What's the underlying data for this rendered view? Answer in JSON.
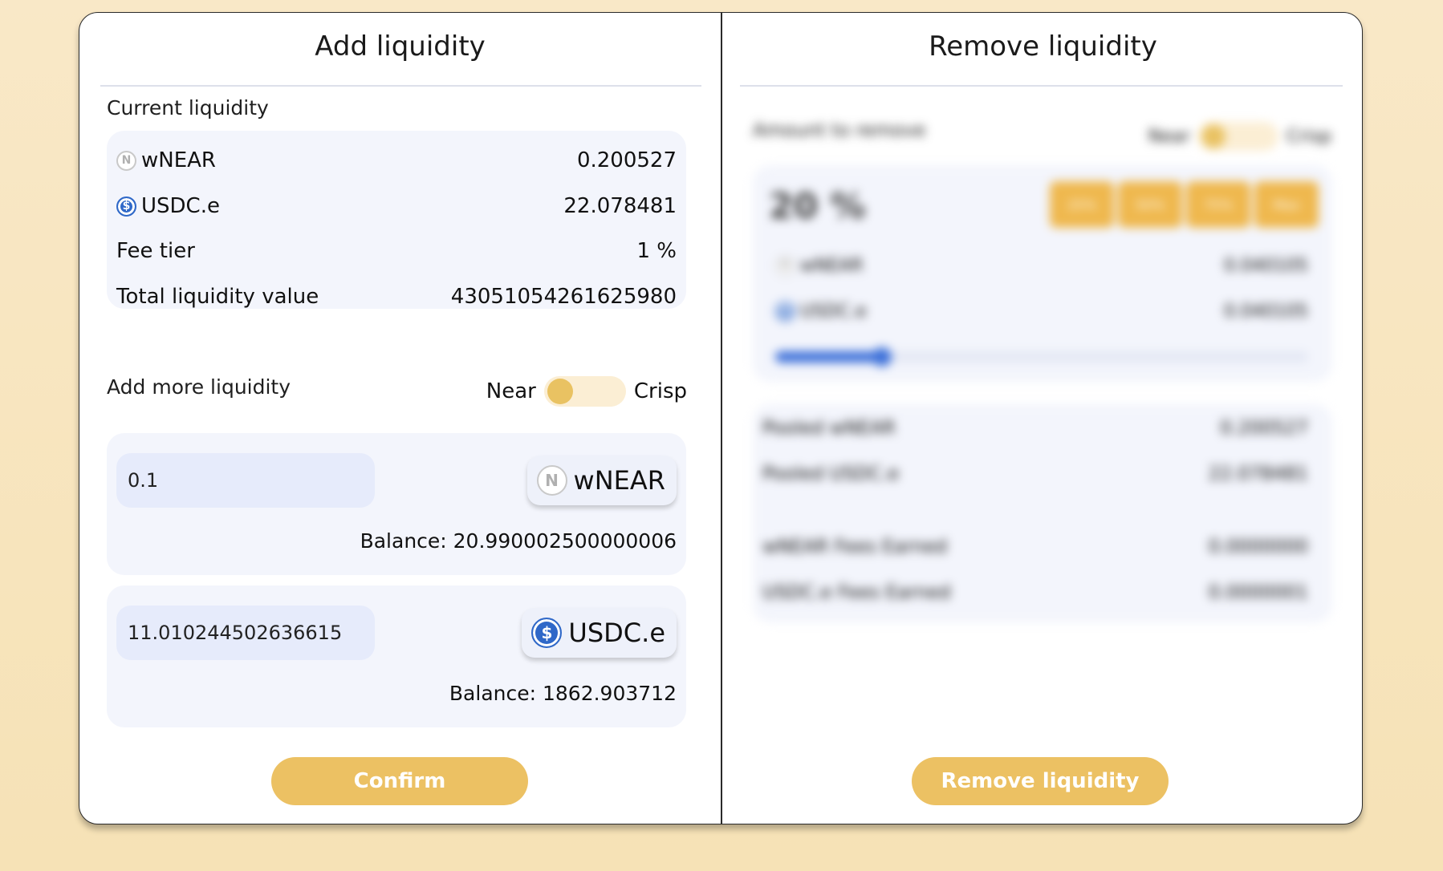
{
  "add_panel": {
    "title": "Add liquidity",
    "current_liquidity_label": "Current liquidity",
    "rows": [
      {
        "label": "wNEAR",
        "value": "0.200527",
        "icon": "near-icon"
      },
      {
        "label": "USDC.e",
        "value": "22.078481",
        "icon": "usdc-icon"
      },
      {
        "label": "Fee tier",
        "value": "1 %"
      },
      {
        "label": "Total liquidity value",
        "value": "43051054261625980"
      }
    ],
    "add_more_label": "Add more liquidity",
    "toggle": {
      "left_label": "Near",
      "right_label": "Crisp"
    },
    "inputs": [
      {
        "value": "0.1",
        "token": "wNEAR",
        "balance": "Balance: 20.990002500000006"
      },
      {
        "value": "11.010244502636615",
        "token": "USDC.e",
        "balance": "Balance: 1862.903712"
      }
    ],
    "confirm_label": "Confirm"
  },
  "remove_panel": {
    "title": "Remove liquidity",
    "amount_label": "Amount to remove",
    "toggle": {
      "left_label": "Near",
      "right_label": "Crisp"
    },
    "percent": "20 %",
    "percent_buttons": [
      "25%",
      "50%",
      "75%",
      "Max"
    ],
    "rows": [
      {
        "label": "wNEAR",
        "value": "0.040105"
      },
      {
        "label": "USDC.e",
        "value": "0.040105"
      }
    ],
    "slider_percent": 20,
    "pooled": [
      {
        "label": "Pooled wNEAR",
        "value": "0.200527"
      },
      {
        "label": "Pooled USDC.e",
        "value": "22.078481"
      }
    ],
    "fees": [
      {
        "label": "wNEAR Fees Earned",
        "value": "0.0000000"
      },
      {
        "label": "USDC.e Fees Earned",
        "value": "0.0000001"
      }
    ],
    "remove_label": "Remove liquidity"
  },
  "colors": {
    "accent": "#ECC163",
    "background": "#F7E4BD",
    "box": "#F3F5FC",
    "input": "#E6EBFB",
    "usdc": "#2F68C8"
  }
}
